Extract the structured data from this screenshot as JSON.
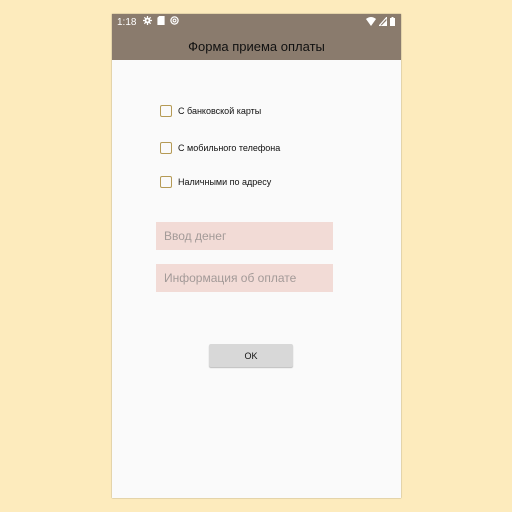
{
  "status_bar": {
    "time": "1:18",
    "left_icons": [
      "gear-icon",
      "sd-card-icon",
      "at-sign-icon"
    ],
    "right_icons": [
      "wifi-icon",
      "signal-icon",
      "battery-icon"
    ],
    "background": "#8a7b6d"
  },
  "app_bar": {
    "title": "Форма приема оплаты"
  },
  "payment_options": [
    {
      "label": "С банковской карты",
      "checked": false
    },
    {
      "label": "С мобильного телефона",
      "checked": false
    },
    {
      "label": "Наличными по адресу",
      "checked": false
    }
  ],
  "amount_field": {
    "placeholder": "Ввод денег",
    "value": ""
  },
  "info_field": {
    "placeholder": "Информация об оплате",
    "value": ""
  },
  "ok_button": {
    "label": "OK"
  },
  "colors": {
    "page_background": "#fdebbd",
    "app_bar": "#8a7b6d",
    "checkbox_border": "#b59a55",
    "field_background": "#f2dbd6",
    "button_background": "#d8d8d8"
  }
}
